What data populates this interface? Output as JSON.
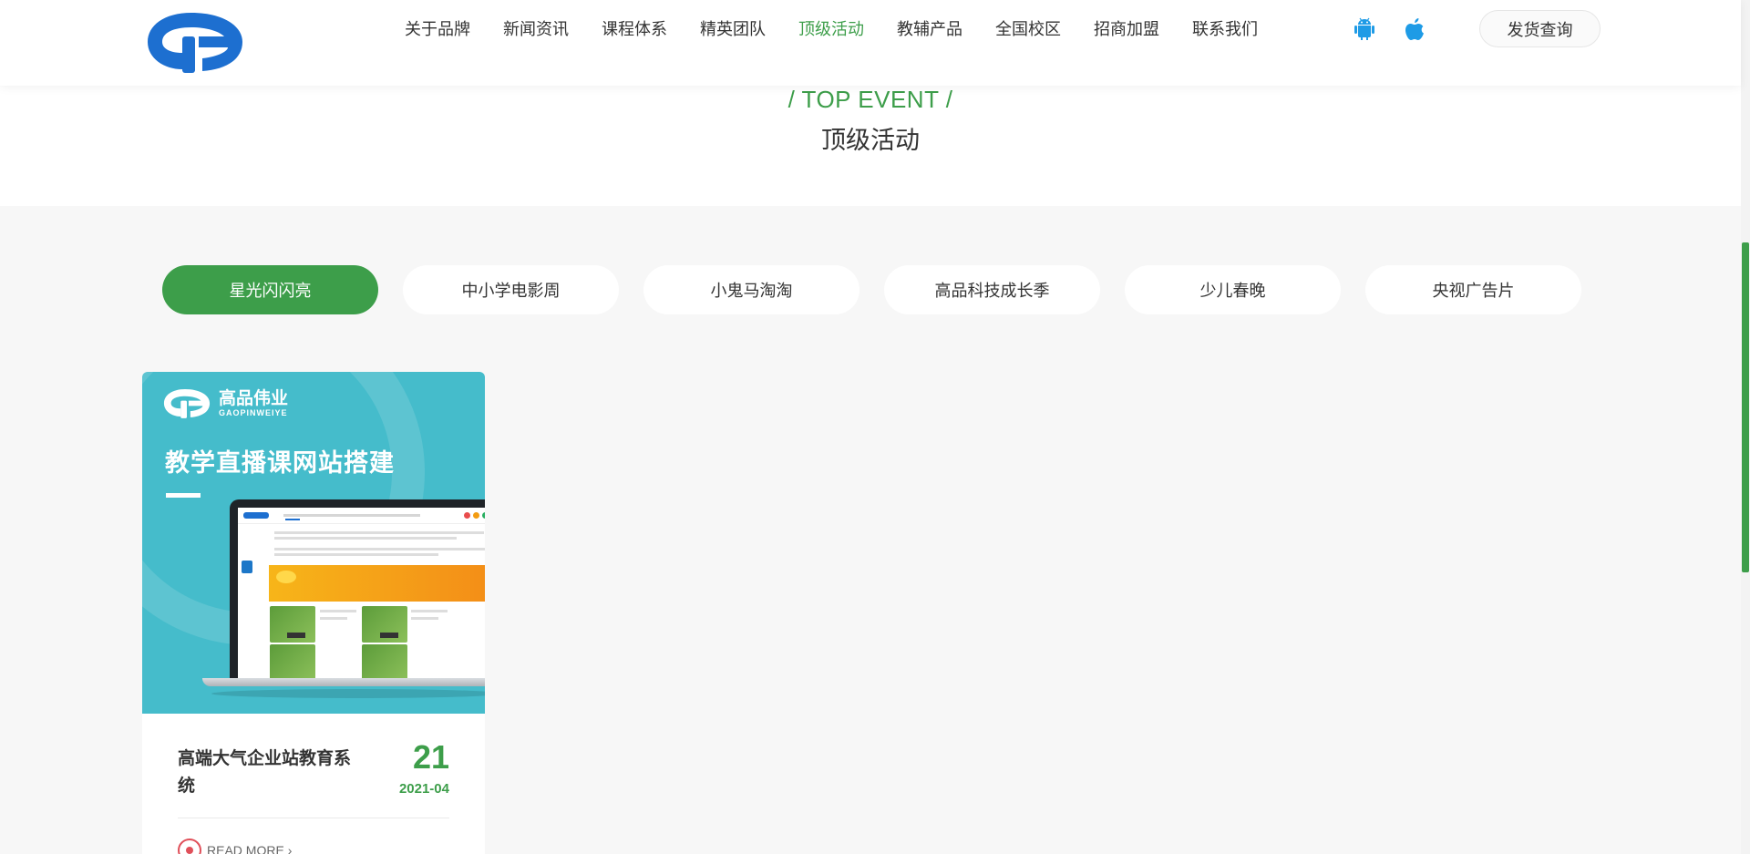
{
  "header": {
    "nav": [
      {
        "label": "关于品牌",
        "active": false
      },
      {
        "label": "新闻资讯",
        "active": false
      },
      {
        "label": "课程体系",
        "active": false
      },
      {
        "label": "精英团队",
        "active": false
      },
      {
        "label": "顶级活动",
        "active": true
      },
      {
        "label": "教辅产品",
        "active": false
      },
      {
        "label": "全国校区",
        "active": false
      },
      {
        "label": "招商加盟",
        "active": false
      },
      {
        "label": "联系我们",
        "active": false
      }
    ],
    "apps": [
      "android-icon",
      "apple-icon"
    ],
    "ship_query": "发货查询"
  },
  "section": {
    "title_en": "/ TOP EVENT /",
    "title_cn": "顶级活动"
  },
  "tabs": [
    {
      "label": "星光闪闪亮",
      "active": true
    },
    {
      "label": "中小学电影周",
      "active": false
    },
    {
      "label": "小鬼马淘淘",
      "active": false
    },
    {
      "label": "高品科技成长季",
      "active": false
    },
    {
      "label": "少儿春晚",
      "active": false
    },
    {
      "label": "央视广告片",
      "active": false
    }
  ],
  "card": {
    "brand_cn": "高品伟业",
    "brand_en": "GAOPINWEIYE",
    "banner_title": "教学直播课网站搭建",
    "title": "高端大气企业站教育系统",
    "day": "21",
    "month": "2021-04",
    "read_more": "READ MORE"
  },
  "colors": {
    "accent": "#3d9e4a",
    "banner": "#45bccb",
    "read_more_ring": "#e0505a"
  }
}
